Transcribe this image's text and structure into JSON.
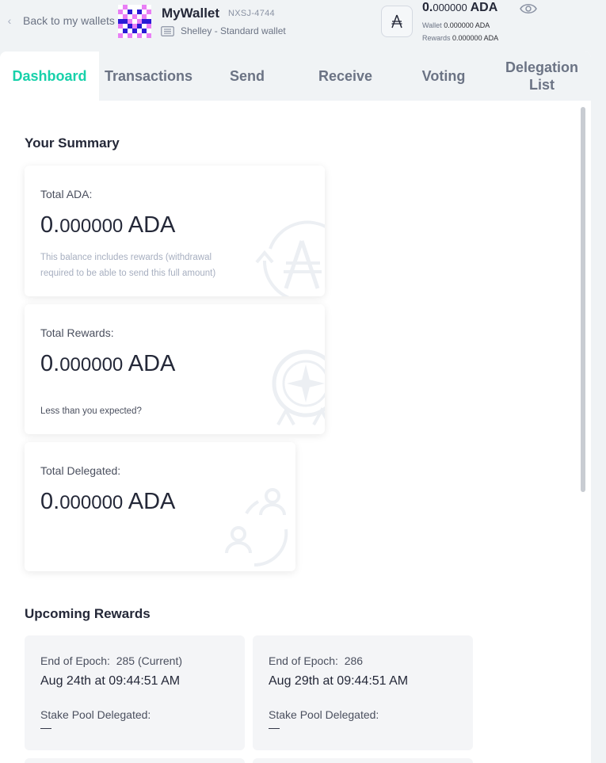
{
  "header": {
    "back_label": "Back to my wallets",
    "wallet_name": "MyWallet",
    "wallet_code": "NXSJ-4744",
    "wallet_type": "Shelley - Standard wallet",
    "balance_int": "0.",
    "balance_dec": "000000",
    "balance_unit": "ADA",
    "wallet_label": "Wallet",
    "wallet_value": "0.000000 ADA",
    "rewards_label": "Rewards",
    "rewards_value": "0.000000 ADA"
  },
  "tabs": [
    {
      "label": "Dashboard",
      "active": true
    },
    {
      "label": "Transactions",
      "active": false
    },
    {
      "label": "Send",
      "active": false
    },
    {
      "label": "Receive",
      "active": false
    },
    {
      "label": "Voting",
      "active": false
    },
    {
      "label": "Delegation List",
      "active": false
    }
  ],
  "summary": {
    "title": "Your Summary",
    "total_ada": {
      "label": "Total ADA:",
      "int": "0.",
      "dec": "000000",
      "unit": " ADA",
      "note": "This balance includes rewards (withdrawal required to be able to send this full amount)"
    },
    "total_rewards": {
      "label": "Total Rewards:",
      "int": "0.",
      "dec": "000000",
      "unit": " ADA",
      "link": "Less than you expected?"
    },
    "total_delegated": {
      "label": "Total Delegated:",
      "int": "0.",
      "dec": "000000",
      "unit": " ADA"
    }
  },
  "upcoming": {
    "title": "Upcoming Rewards",
    "cards": [
      {
        "epoch_label": "End of Epoch:",
        "epoch": "285 (Current)",
        "date": "Aug 24th at 09:44:51 AM",
        "pool_label": "Stake Pool Delegated:",
        "pool_value": "—"
      },
      {
        "epoch_label": "End of Epoch:",
        "epoch": "286",
        "date": "Aug 29th at 09:44:51 AM",
        "pool_label": "Stake Pool Delegated:",
        "pool_value": "—"
      }
    ]
  },
  "colors": {
    "accent": "#17d1aa",
    "background": "#f0f3f5",
    "text_primary": "#242838",
    "text_secondary": "#6b7384"
  },
  "icons": {
    "back": "chevron-left-icon",
    "avatar": "wallet-identicon",
    "wallet_type": "card-icon",
    "ada": "ada-logo-icon",
    "visibility": "eye-icon"
  }
}
